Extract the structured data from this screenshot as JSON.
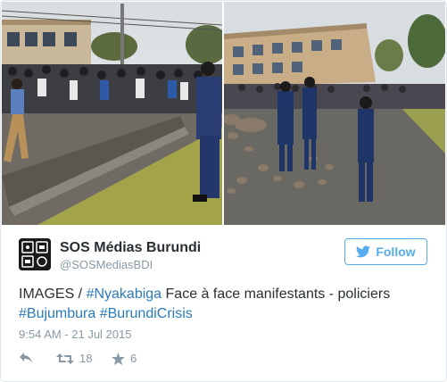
{
  "tweet": {
    "author_name": "SOS Médias Burundi",
    "author_handle": "@SOSMediasBDI",
    "follow_label": "Follow",
    "text_prefix": "IMAGES / ",
    "hashtag_1": "#Nyakabiga",
    "text_middle": " Face à face manifestants - policiers",
    "hashtag_2": "#Bujumbura",
    "hashtag_3": "#BurundiCrisis",
    "timestamp": "9:54 AM - 21 Jul 2015",
    "retweet_count": "18",
    "favorite_count": "6"
  },
  "media": {
    "left_photo": "protesters-crowd-street-photo",
    "right_photo": "police-facing-rocks-street-photo"
  },
  "icons": {
    "reply": "reply-icon",
    "retweet": "retweet-icon",
    "favorite": "star-icon",
    "follow": "twitter-bird-icon"
  },
  "colors": {
    "link": "#2b7bb9",
    "accent": "#55acee",
    "muted": "#8899a6",
    "text": "#292f33"
  }
}
